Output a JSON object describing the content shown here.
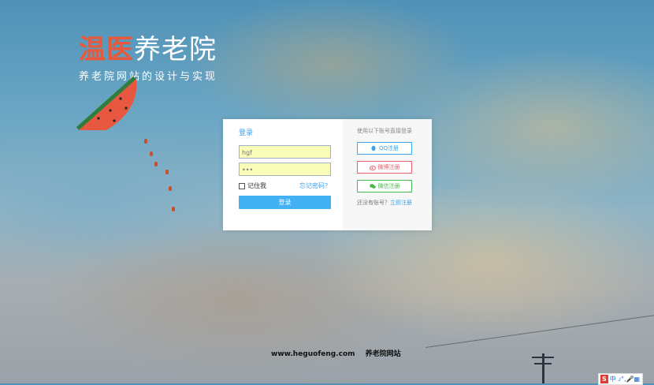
{
  "brand": {
    "title_accent": "温医",
    "title_rest": "养老院",
    "subtitle": "养老院网站的设计与实现"
  },
  "login": {
    "title": "登录",
    "username_value": "hgf",
    "password_value": "•••",
    "remember_label": "记住我",
    "forgot_label": "忘记密码？",
    "submit_label": "登录"
  },
  "social": {
    "title": "使用以下账号直接登录",
    "qq_label": "QQ注册",
    "weibo_label": "微博注册",
    "wechat_label": "微信注册",
    "register_prompt": "还没有账号？",
    "register_link": "立即注册"
  },
  "footer": {
    "site": "www.heguofeng.com",
    "name": "养老院网站"
  },
  "ime": {
    "logo": "S",
    "lang": "中",
    "symbols": "ᴊ°,🎤▦"
  },
  "colors": {
    "accent": "#e8583b",
    "link": "#3aa2e8",
    "button": "#41b1f4",
    "weibo": "#e85b6b",
    "wechat": "#48b84a"
  }
}
